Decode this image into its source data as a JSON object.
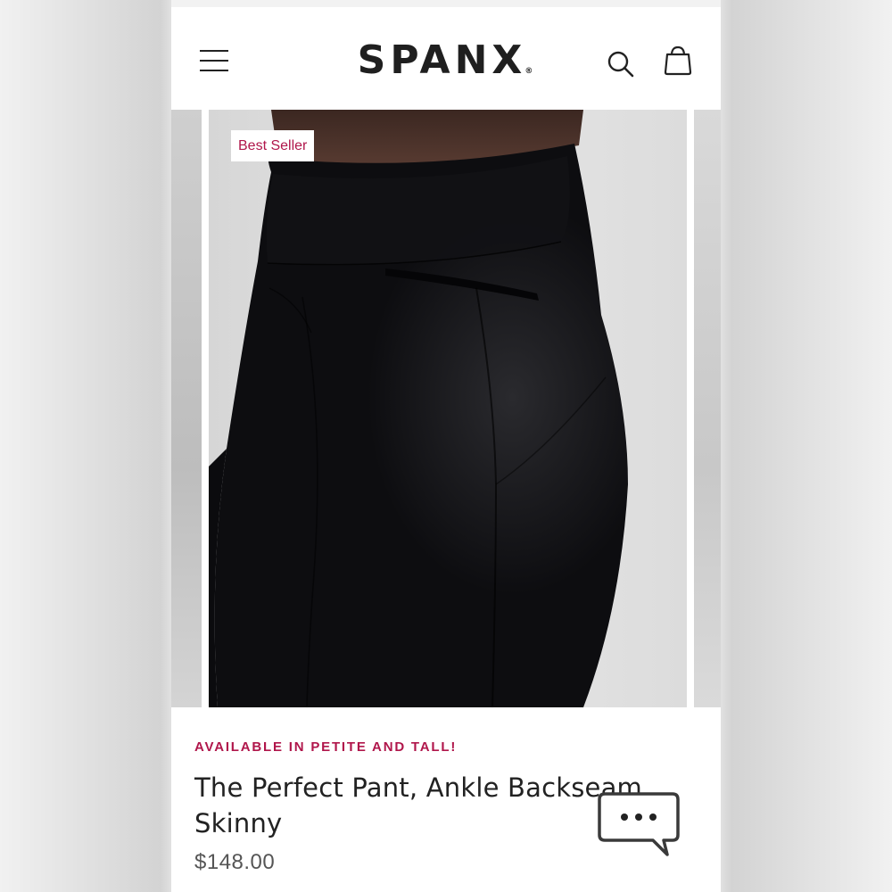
{
  "header": {
    "brand": "SPANX",
    "trademark": "®",
    "icons": [
      "hamburger-menu-icon",
      "search-icon",
      "shopping-bag-icon"
    ]
  },
  "product": {
    "badge": "Best Seller",
    "promo": "AVAILABLE IN PETITE AND TALL!",
    "title": "The Perfect Pant, Ankle Backseam Skinny",
    "price": "$148.00"
  },
  "chat": {
    "icon": "chat-bubble-icon"
  },
  "colors": {
    "accent": "#b0164b",
    "text": "#222222",
    "price": "#555555",
    "background": "#ffffff"
  }
}
